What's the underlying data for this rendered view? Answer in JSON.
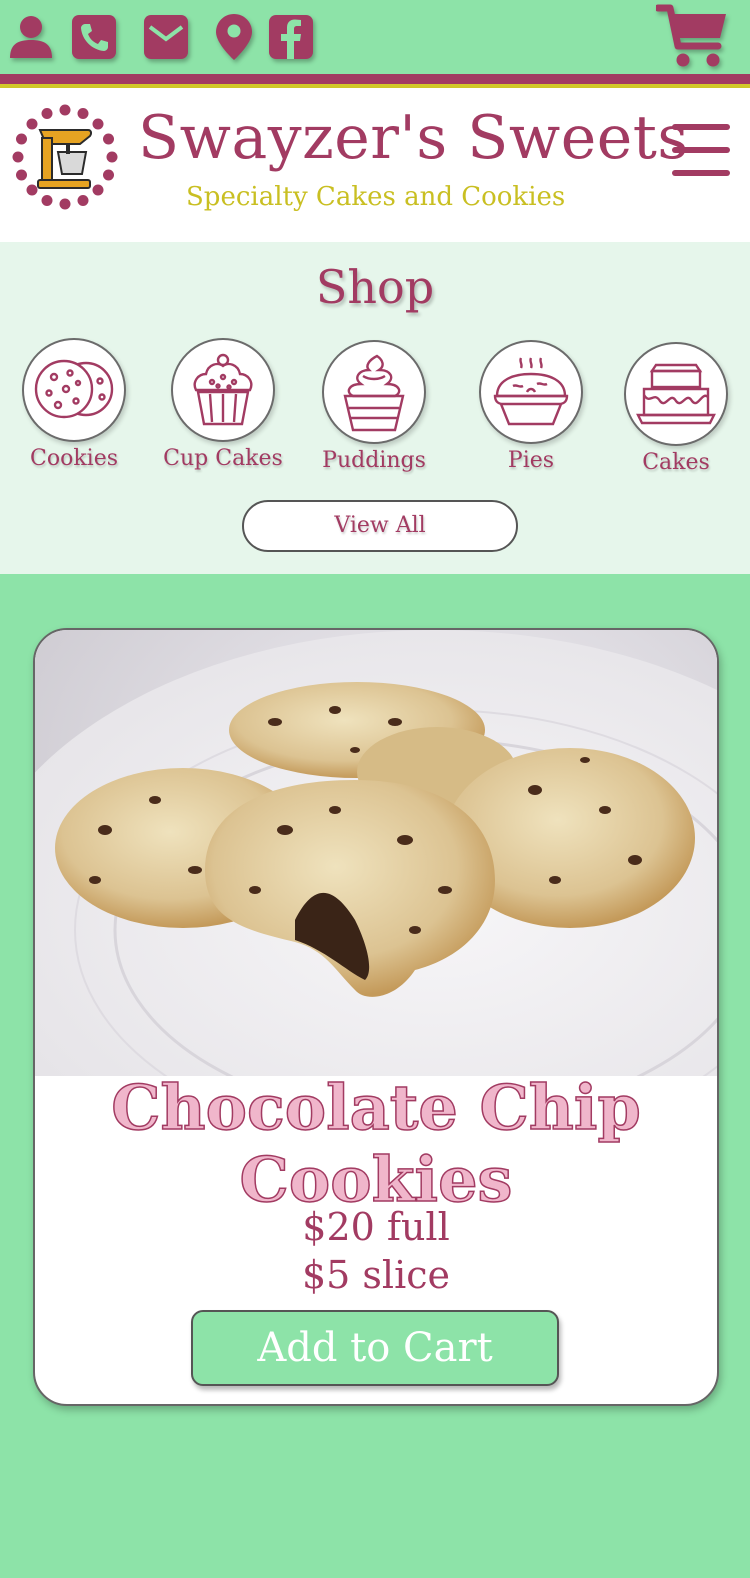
{
  "topbar": {
    "icons": [
      "user-icon",
      "phone-icon",
      "envelope-icon",
      "map-pin-icon",
      "facebook-icon"
    ],
    "cart_icon": "shopping-cart-icon"
  },
  "header": {
    "brand": "Swayzer's Sweets",
    "tagline": "Specialty Cakes and Cookies",
    "logo_icon": "stand-mixer-logo",
    "menu_icon": "hamburger-menu-icon"
  },
  "shop": {
    "title": "Shop",
    "categories": [
      {
        "label": "Cookies",
        "icon": "cookies-icon"
      },
      {
        "label": "Cup Cakes",
        "icon": "cupcake-icon"
      },
      {
        "label": "Puddings",
        "icon": "pudding-icon"
      },
      {
        "label": "Pies",
        "icon": "pie-icon"
      },
      {
        "label": "Cakes",
        "icon": "cake-icon"
      }
    ],
    "view_all": "View All"
  },
  "product": {
    "name_line1": "Chocolate Chip",
    "name_line2": "Cookies",
    "price_full": "$20 full",
    "price_slice": "$5 slice",
    "add_to_cart": "Add to Cart",
    "image": "chocolate-chip-cookies-photo"
  },
  "colors": {
    "brand": "#a23b62",
    "accent_green": "#8de3a8",
    "accent_yellow": "#d2c929",
    "shop_bg": "#e6f6eb",
    "product_title_fill": "#f0b6cb"
  }
}
